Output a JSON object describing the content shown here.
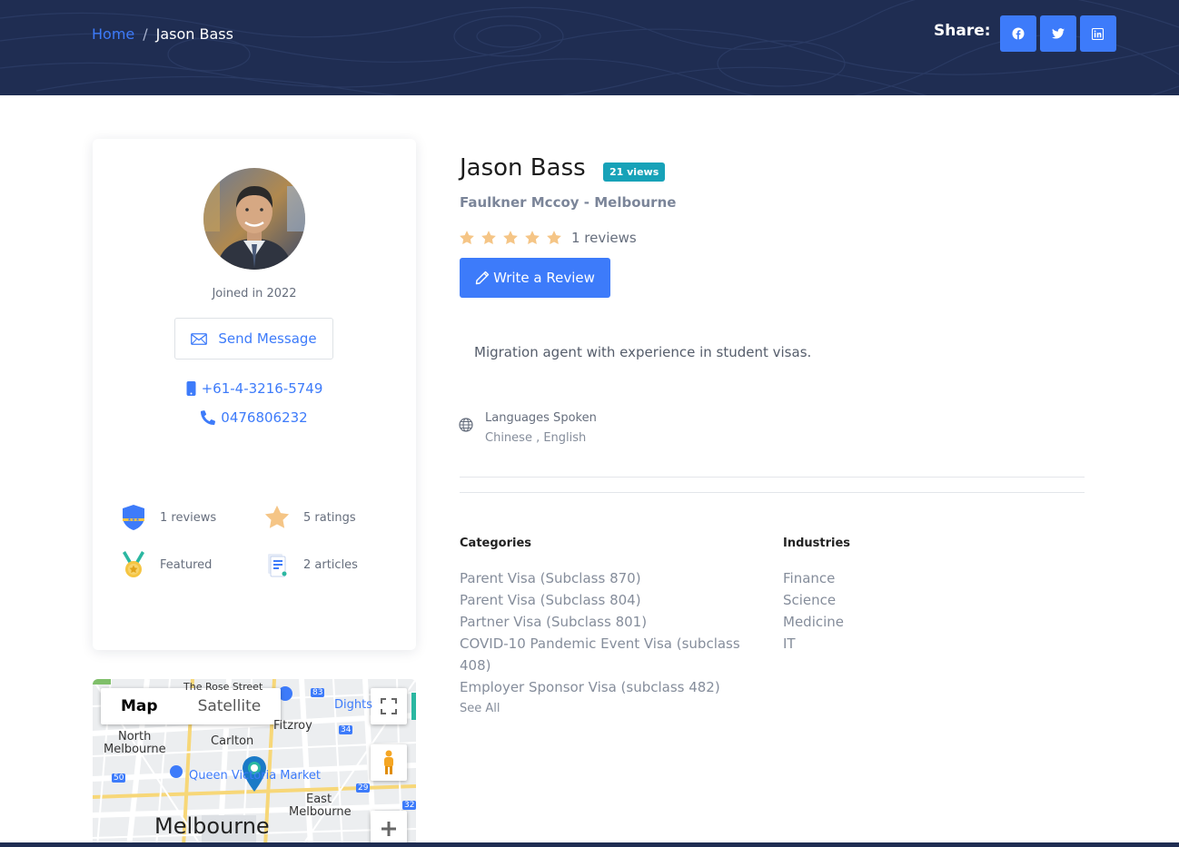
{
  "breadcrumb": {
    "home": "Home",
    "separator": "/",
    "current": "Jason Bass"
  },
  "share": {
    "label": "Share:",
    "buttons": [
      {
        "icon": "facebook-icon"
      },
      {
        "icon": "twitter-icon"
      },
      {
        "icon": "linkedin-icon"
      }
    ]
  },
  "profile": {
    "joined": "Joined in 2022",
    "send_message": "Send Message",
    "mobile": "+61-4-3216-5749",
    "phone": "0476806232",
    "stats": {
      "reviews": "1 reviews",
      "ratings": "5 ratings",
      "featured": "Featured",
      "articles": "2 articles"
    }
  },
  "map": {
    "tab_map": "Map",
    "tab_satellite": "Satellite",
    "labels": {
      "north_melbourne_1": "North",
      "north_melbourne_2": "Melbourne",
      "carlton": "Carlton",
      "fitzroy": "Fitzroy",
      "queen_victoria": "Queen Victoria Market",
      "east_melbourne_1": "East",
      "east_melbourne_2": "Melbourne",
      "melbourne": "Melbourne",
      "dights": "Dights",
      "the_rose_street": "The Rose Street",
      "route_83": "83",
      "route_34": "34",
      "route_50": "50",
      "route_29": "29",
      "route_32": "32"
    }
  },
  "agent": {
    "name": "Jason Bass",
    "views": "21 views",
    "company": "Faulkner Mccoy - Melbourne",
    "rating": 5,
    "rating_max": 5,
    "reviews": "1 reviews",
    "write_review": "Write a Review",
    "bio": "Migration agent with experience in student visas.",
    "languages_label": "Languages Spoken",
    "languages": "Chinese , English"
  },
  "categories": {
    "title": "Categories",
    "items": [
      "Parent Visa (Subclass 870)",
      "Parent Visa (Subclass 804)",
      "Partner Visa (Subclass 801)",
      "COVID-10 Pandemic Event Visa (subclass",
      "408)",
      "Employer Sponsor Visa (subclass 482)"
    ],
    "see_all": "See All"
  },
  "industries": {
    "title": "Industries",
    "items": [
      "Finance",
      "Science",
      "Medicine",
      "IT"
    ]
  },
  "colors": {
    "header_bg": "#1f2d52",
    "accent": "#3d7bfa",
    "badge": "#17a2b8",
    "star": "#f5c586"
  }
}
